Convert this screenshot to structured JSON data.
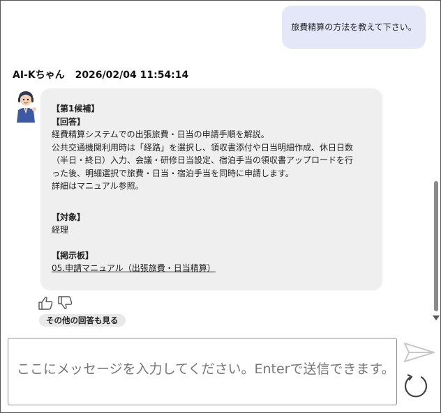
{
  "user_message": "旅費精算の方法を教えて下さい。",
  "bot": {
    "name": "AI-Kちゃん",
    "timestamp": "2026/02/04 11:54:14",
    "candidate_label": "【第1候補】",
    "answer_label": "【回答】",
    "answer_lines": [
      "経費精算システムでの出張旅費・日当の申請手順を解説。",
      "公共交通機関利用時は「経路」を選択し、領収書添付や日当明細作成、休日日数",
      "（半日・終日）入力、会議・研修日当設定、宿泊手当の領収書アップロードを行",
      "った後、明細選択で旅費・日当・宿泊手当を同時に申請します。",
      "詳細はマニュアル参照。"
    ],
    "target_label": "【対象】",
    "target_value": "経理",
    "board_label": "【掲示板】",
    "board_link": "05.申請マニュアル（出張旅費・日当精算）"
  },
  "feedback": {
    "like_icon": "thumbs-up-icon",
    "dislike_icon": "thumbs-down-icon"
  },
  "more_answers_label": "その他の回答も見る",
  "input": {
    "placeholder": "ここにメッセージを入力してください。Enterで送信できます。"
  },
  "icons": {
    "send": "send-icon",
    "reset": "refresh-icon"
  },
  "colors": {
    "user_bubble": "#e3e7f8",
    "bot_bubble": "#efefef",
    "scroll_thumb": "#8a8a8a"
  }
}
